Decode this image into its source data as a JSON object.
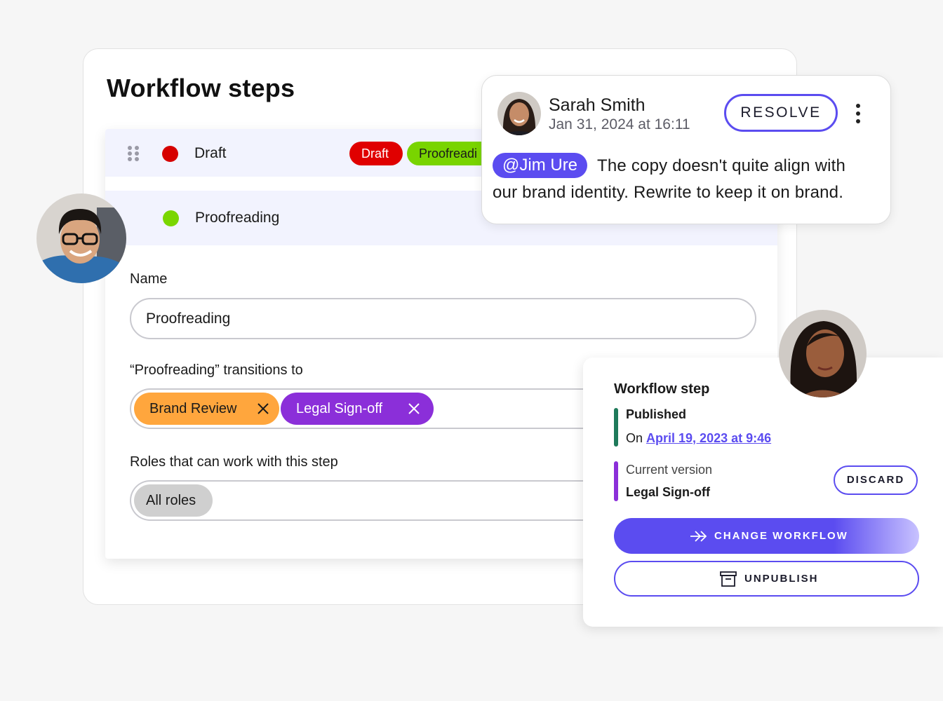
{
  "main": {
    "title": "Workflow steps",
    "steps": [
      {
        "label": "Draft",
        "color": "#d60000"
      },
      {
        "label": "Proofreading",
        "color": "#7ad600"
      }
    ],
    "chips": [
      {
        "label": "Draft",
        "color": "#e00000",
        "text_color": "#ffffff"
      },
      {
        "label": "Proofreadi",
        "color": "#79d400",
        "text_color": "#1a1a1a"
      }
    ],
    "name_label": "Name",
    "name_value": "Proofreading",
    "transitions_label": "“Proofreading” transitions to",
    "transitions": [
      {
        "label": "Brand Review",
        "color": "#ffa63d"
      },
      {
        "label": "Legal Sign-off",
        "color": "#8b2fd9"
      }
    ],
    "roles_label": "Roles that can work with this step",
    "roles": [
      {
        "label": "All roles"
      }
    ]
  },
  "comment": {
    "author": "Sarah Smith",
    "date": "Jan 31, 2024 at 16:11",
    "resolve_label": "RESOLVE",
    "mention": "@Jim Ure",
    "line1": "The copy doesn't quite align with",
    "line2": "our brand identity. Rewrite to keep it on brand."
  },
  "workflow": {
    "title": "Workflow step",
    "status": "Published",
    "on_prefix": "On",
    "date_link": "April 19, 2023 at 9:46",
    "version_label": "Current version",
    "version_value": "Legal Sign-off",
    "discard_label": "DISCARD",
    "change_label": "CHANGE WORKFLOW",
    "unpublish_label": "UNPUBLISH",
    "accent_color": "#5b4cf0",
    "published_bar_color": "#1e7a5a",
    "version_bar_color": "#8b2fd9"
  },
  "icons": [
    "drag-handle-icon",
    "close-icon",
    "more-vertical-icon",
    "arrow-right-icon",
    "archive-icon"
  ]
}
